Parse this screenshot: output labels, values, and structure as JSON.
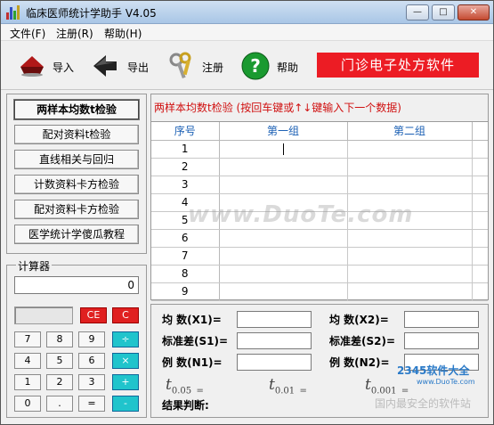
{
  "window": {
    "title": "临床医师统计学助手 V4.05",
    "buttons": {
      "minimize": "—",
      "maximize": "□",
      "close": "✕"
    }
  },
  "menu": [
    "文件(F)",
    "注册(R)",
    "帮助(H)"
  ],
  "toolbar": {
    "import": "导入",
    "export": "导出",
    "register": "注册",
    "help": "帮助",
    "promo": "门诊电子处方软件"
  },
  "nav": [
    "两样本均数t检验",
    "配对资料t检验",
    "直线相关与回归",
    "计数资料卡方检验",
    "配对资料卡方检验",
    "医学统计学傻瓜教程"
  ],
  "calculator": {
    "title": "计算器",
    "display": "0",
    "keys": [
      "CE",
      "C",
      "7",
      "8",
      "9",
      "÷",
      "4",
      "5",
      "6",
      "×",
      "1",
      "2",
      "3",
      "+",
      "0",
      ".",
      "=",
      "-"
    ]
  },
  "main": {
    "heading": "两样本均数t检验 (按回车键或↑↓键输入下一个数据)",
    "columns": [
      "序号",
      "第一组",
      "第二组"
    ],
    "rows": [
      "1",
      "2",
      "3",
      "4",
      "5",
      "6",
      "7",
      "8",
      "9"
    ]
  },
  "results": {
    "mean1": "均  数(X1)=",
    "mean2": "均  数(X2)=",
    "sd1": "标准差(S1)=",
    "sd2": "标准差(S2)=",
    "n1": "例  数(N1)=",
    "n2": "例  数(N2)=",
    "t005_main": "t",
    "t005_sub": "0.05",
    "t005_eq": "=",
    "t001_main": "t",
    "t001_sub": "0.01",
    "t001_eq": "=",
    "t0001_main": "t",
    "t0001_sub": "0.001",
    "t0001_eq": "=",
    "verdict": "结果判断:"
  },
  "watermark": {
    "text": "www.DuoTe.com",
    "logo1": "2345软件大全",
    "logo2": "www.DuoTe.com",
    "logo3": "国内最安全的软件站"
  }
}
